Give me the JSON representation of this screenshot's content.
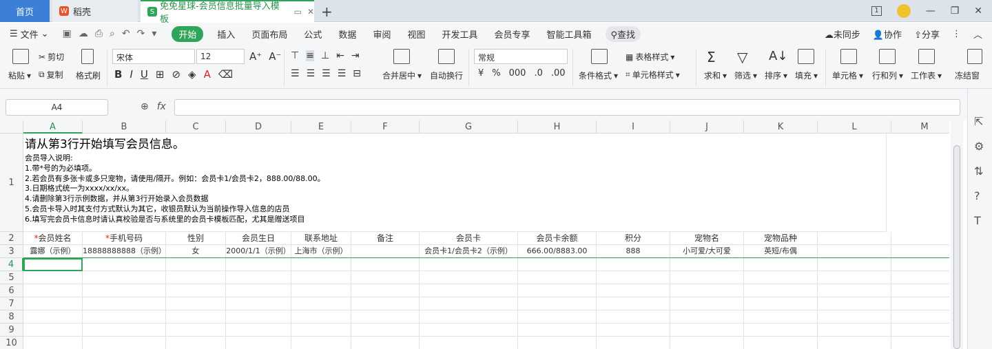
{
  "tabs": {
    "home": "首页",
    "doc": "稻壳",
    "active": "免免星球-会员信息批量导入模板"
  },
  "win": {
    "badge": "1"
  },
  "menu": {
    "file": "文件",
    "tabs": [
      "开始",
      "插入",
      "页面布局",
      "公式",
      "数据",
      "审阅",
      "视图",
      "开发工具",
      "会员专享",
      "智能工具箱"
    ],
    "search": "查找",
    "sync": "未同步",
    "collab": "协作",
    "share": "分享"
  },
  "ribbon": {
    "paste": "粘贴",
    "cut": "剪切",
    "copy": "复制",
    "format_painter": "格式刷",
    "font": "宋体",
    "size": "12",
    "merge": "合并居中",
    "wrap": "自动换行",
    "numfmt": "常规",
    "cond": "条件格式",
    "table_style": "表格样式",
    "cell_style": "单元格样式",
    "sum": "求和",
    "filter": "筛选",
    "sort": "排序",
    "fill": "填充",
    "cell": "单元格",
    "rowcol": "行和列",
    "sheet": "工作表",
    "freeze": "冻结窗"
  },
  "namebox": "A4",
  "columns": [
    "A",
    "B",
    "C",
    "D",
    "E",
    "F",
    "G",
    "H",
    "I",
    "J",
    "K",
    "L",
    "M"
  ],
  "rows": [
    "1",
    "2",
    "3",
    "4",
    "5",
    "6",
    "7",
    "8",
    "9",
    "10"
  ],
  "instructions": {
    "title": "请从第3行开始填写会员信息。",
    "lines": [
      "会员导入说明:",
      "1.带*号的为必填项。",
      "2.若会员有多张卡或多只宠物，请使用/隔开。例如：会员卡1/会员卡2，888.00/88.00。",
      "3.日期格式统一为xxxx/xx/xx。",
      "4.请删除第3行示例数据，并从第3行开始录入会员数据",
      "5.会员卡导入时其支付方式默认为其它，收银员默认为当前操作导入信息的店员",
      "6.填写完会员卡信息时请认真校验是否与系统里的会员卡模板匹配，尤其是赠送项目"
    ]
  },
  "headers": [
    {
      "req": "*",
      "text": "会员姓名"
    },
    {
      "req": "*",
      "text": "手机号码"
    },
    {
      "req": "",
      "text": "性别"
    },
    {
      "req": "",
      "text": "会员生日"
    },
    {
      "req": "",
      "text": "联系地址"
    },
    {
      "req": "",
      "text": "备注"
    },
    {
      "req": "",
      "text": "会员卡"
    },
    {
      "req": "",
      "text": "会员卡余额"
    },
    {
      "req": "",
      "text": "积分"
    },
    {
      "req": "",
      "text": "宠物名"
    },
    {
      "req": "",
      "text": "宠物品种"
    }
  ],
  "example": [
    "露娜（示例）",
    "18888888888（示例）",
    "女",
    "2000/1/1（示例）",
    "上海市（示例）",
    "",
    "会员卡1/会员卡2（示例）",
    "666.00/8883.00",
    "888",
    "小可爱/大可爱",
    "英短/布偶"
  ]
}
